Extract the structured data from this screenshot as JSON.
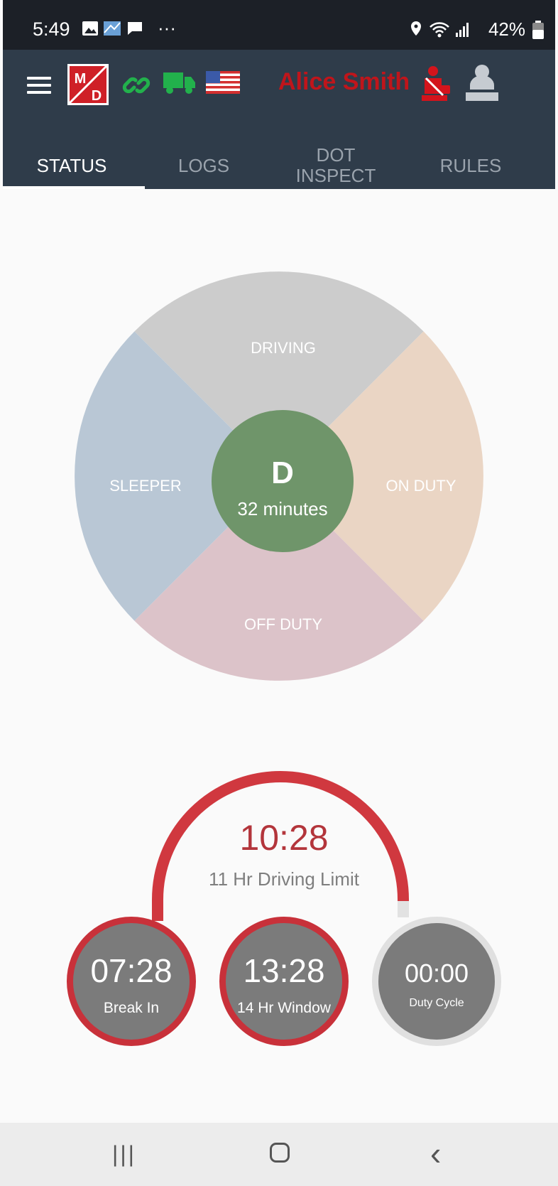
{
  "status_bar": {
    "time": "5:49",
    "battery": "42%",
    "icons": [
      "gallery-icon",
      "app-icon",
      "message-icon",
      "more-icon",
      "location-icon",
      "wifi-icon",
      "signal-icon",
      "battery-icon"
    ],
    "more": "···"
  },
  "app_bar": {
    "logo_top": "M",
    "logo_bottom": "D",
    "driver_name": "Alice Smith",
    "colors": {
      "background": "#2f3c4a",
      "driver_name": "#c0151b",
      "connected": "#22b14c"
    }
  },
  "tabs": [
    {
      "label": "STATUS",
      "active": true
    },
    {
      "label": "LOGS",
      "active": false
    },
    {
      "label": "DOT\nINSPECT",
      "active": false
    },
    {
      "label": "RULES",
      "active": false
    }
  ],
  "duty_wheel": {
    "segments": [
      {
        "label": "DRIVING",
        "color": "#cccccc"
      },
      {
        "label": "ON DUTY",
        "color": "#ead5c4"
      },
      {
        "label": "OFF DUTY",
        "color": "#dcc3c9"
      },
      {
        "label": "SLEEPER",
        "color": "#b9c7d5"
      }
    ],
    "current_status": "D",
    "current_duration": "32 minutes",
    "center_color": "#6f956a"
  },
  "driving_limit": {
    "value": "10:28",
    "label": "11 Hr Driving Limit",
    "color": "#c2373d"
  },
  "timers": [
    {
      "value": "07:28",
      "label": "Break In",
      "progress": 0.94
    },
    {
      "value": "13:28",
      "label": "14 Hr Window",
      "progress": 0.96
    },
    {
      "value": "00:00",
      "label": "Duty Cycle",
      "progress": 0.0
    }
  ],
  "nav_bar": {
    "recent": "|||",
    "back": "‹"
  }
}
